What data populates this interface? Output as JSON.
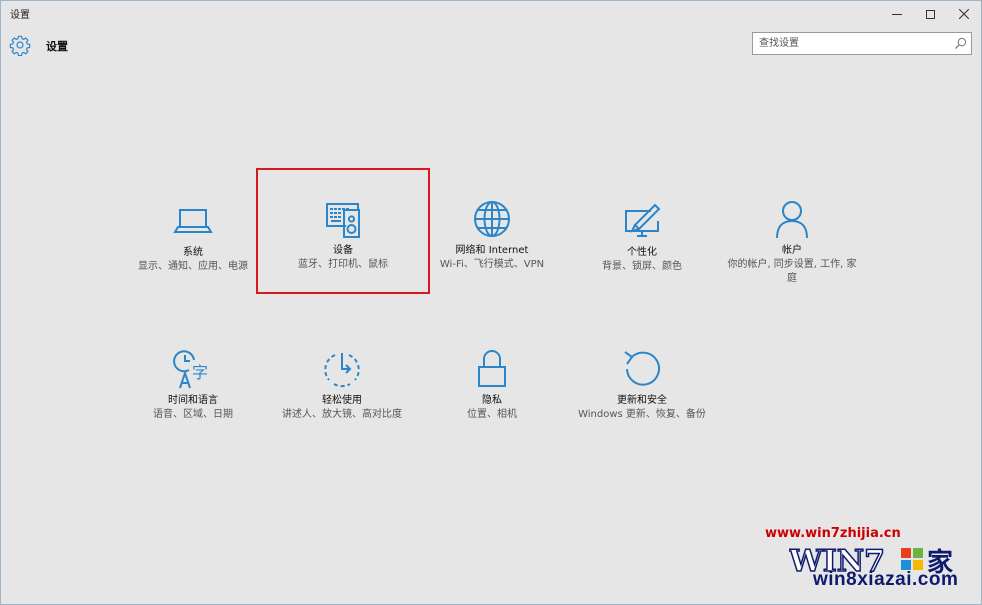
{
  "window": {
    "title": "设置",
    "controls": [
      "minimize-icon",
      "maximize-icon",
      "close-icon"
    ]
  },
  "header": {
    "icon": "gear-icon",
    "title": "设置",
    "search_placeholder": "查找设置",
    "search_icon": "search-icon"
  },
  "colors": {
    "accent": "#2b86c9",
    "background": "#e6e6e6",
    "highlight_box": "#d9181e"
  },
  "tiles": [
    {
      "icon": "laptop-icon",
      "name": "系统",
      "desc": "显示、通知、应用、电源"
    },
    {
      "icon": "keyboard-speaker-icon",
      "name": "设备",
      "desc": "蓝牙、打印机、鼠标",
      "highlighted": true
    },
    {
      "icon": "globe-icon",
      "name": "网络和 Internet",
      "desc": "Wi-Fi、飞行模式、VPN"
    },
    {
      "icon": "paint-screen-icon",
      "name": "个性化",
      "desc": "背景、锁屏、颜色"
    },
    {
      "icon": "person-icon",
      "name": "帐户",
      "desc": "你的帐户, 同步设置, 工作, 家庭"
    },
    {
      "icon": "time-language-icon",
      "name": "时间和语言",
      "desc": "语音、区域、日期"
    },
    {
      "icon": "ease-of-access-icon",
      "name": "轻松使用",
      "desc": "讲述人、放大镜、高对比度"
    },
    {
      "icon": "lock-icon",
      "name": "隐私",
      "desc": "位置、相机"
    },
    {
      "icon": "refresh-icon",
      "name": "更新和安全",
      "desc": "Windows 更新、恢复、备份"
    }
  ],
  "watermark": {
    "url": "www.win7zhijia.cn",
    "site": "win8xiazai.com"
  }
}
